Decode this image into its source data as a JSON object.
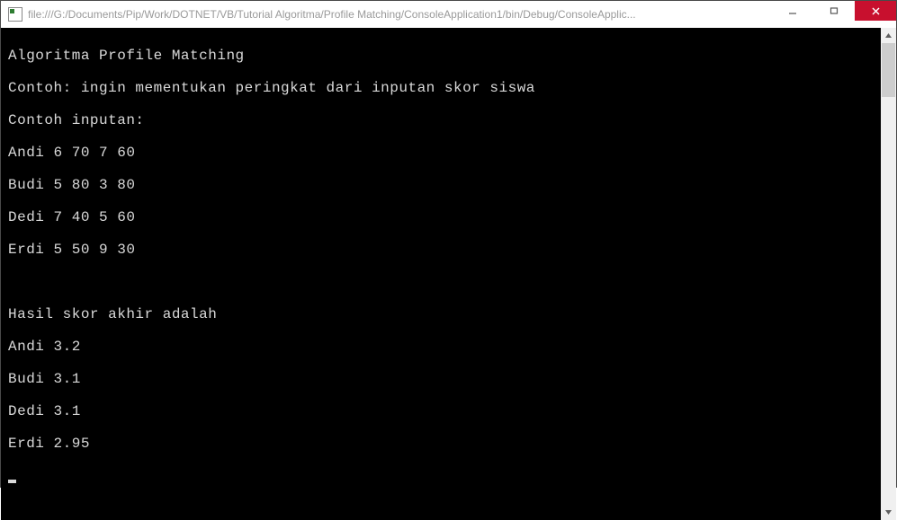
{
  "titlebar": {
    "title": "file:///G:/Documents/Pip/Work/DOTNET/VB/Tutorial Algoritma/Profile Matching/ConsoleApplication1/bin/Debug/ConsoleApplic..."
  },
  "console": {
    "lines": [
      "Algoritma Profile Matching",
      "Contoh: ingin mementukan peringkat dari inputan skor siswa",
      "Contoh inputan:",
      "Andi 6 70 7 60",
      "Budi 5 80 3 80",
      "Dedi 7 40 5 60",
      "Erdi 5 50 9 30",
      "",
      "Hasil skor akhir adalah",
      "Andi 3.2",
      "Budi 3.1",
      "Dedi 3.1",
      "Erdi 2.95"
    ]
  }
}
